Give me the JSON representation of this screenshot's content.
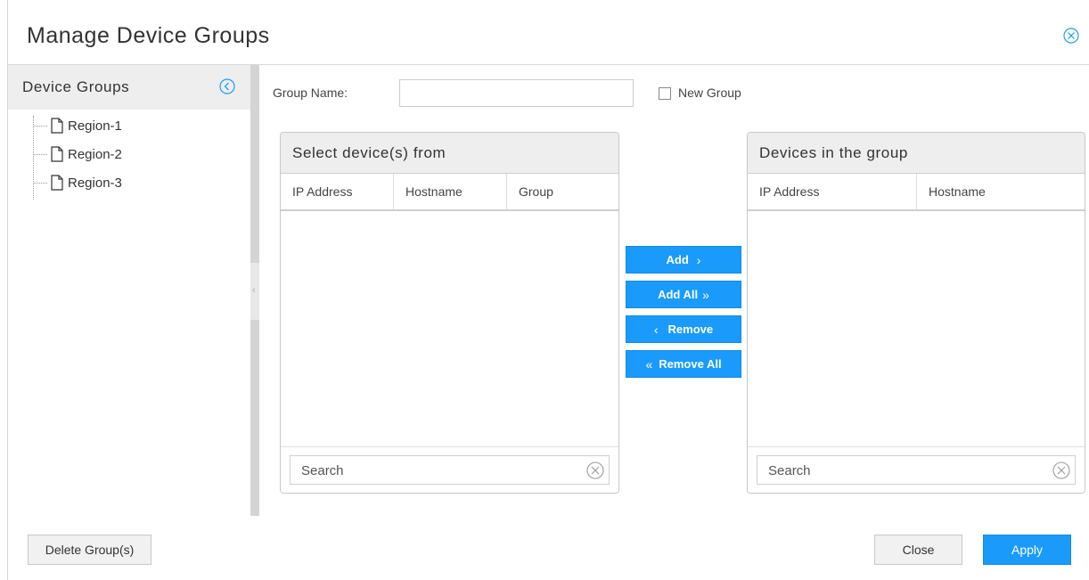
{
  "dialog": {
    "title": "Manage Device Groups"
  },
  "left_panel": {
    "title": "Device Groups",
    "items": [
      {
        "label": "Region-1"
      },
      {
        "label": "Region-2"
      },
      {
        "label": "Region-3"
      }
    ]
  },
  "form": {
    "group_name_label": "Group Name:",
    "group_name_value": "",
    "new_group_label": "New Group",
    "new_group_checked": false
  },
  "source_grid": {
    "title": "Select device(s) from",
    "columns": [
      "IP Address",
      "Hostname",
      "Group"
    ],
    "rows": [],
    "search_placeholder": "Search"
  },
  "target_grid": {
    "title": "Devices in the group",
    "columns": [
      "IP Address",
      "Hostname"
    ],
    "rows": [],
    "search_placeholder": "Search"
  },
  "transfer": {
    "add_label": "Add",
    "add_all_label": "Add All",
    "remove_label": "Remove",
    "remove_all_label": "Remove All"
  },
  "footer": {
    "delete_label": "Delete Group(s)",
    "close_label": "Close",
    "apply_label": "Apply"
  },
  "colors": {
    "accent": "#1a9bfc",
    "header_bg": "#eeeeee"
  }
}
